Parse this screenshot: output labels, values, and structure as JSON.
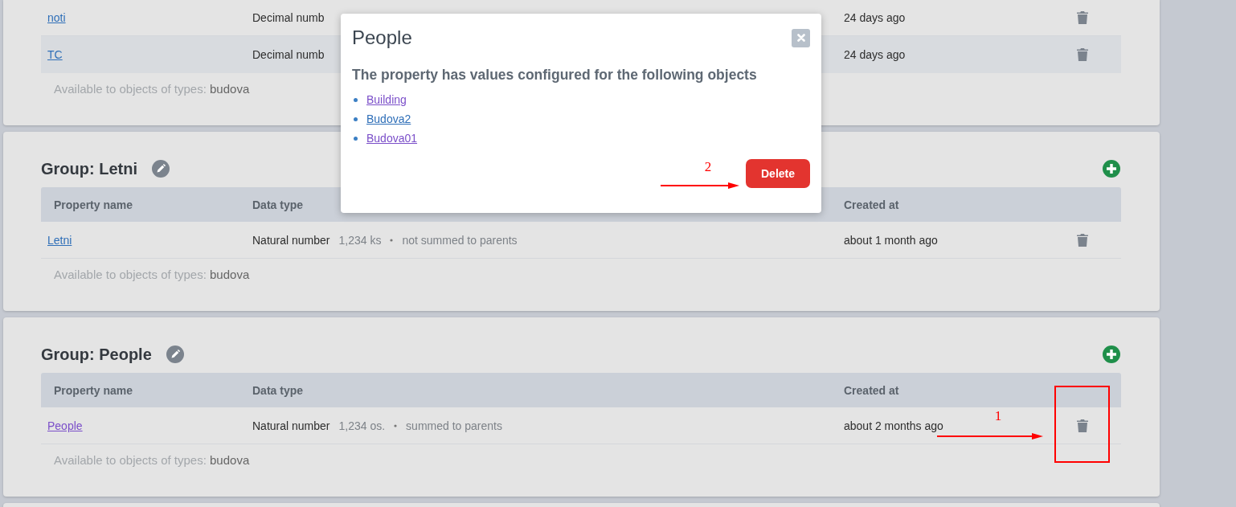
{
  "groups": [
    {
      "rows": [
        {
          "name": "noti",
          "visited": false,
          "highlighted": false,
          "data_type": "Decimal numb",
          "created": "24 days ago"
        },
        {
          "name": "TC",
          "visited": false,
          "highlighted": true,
          "data_type": "Decimal numb",
          "created": "24 days ago"
        }
      ],
      "available_label": "Available to objects of types:",
      "available_types": "budova"
    },
    {
      "title": "Group: Letni",
      "columns": [
        "Property name",
        "Data type",
        "Created at"
      ],
      "rows": [
        {
          "name": "Letni",
          "visited": false,
          "highlighted": false,
          "data_type": "Natural number",
          "example": "1,234 ks",
          "summing": "not summed to parents",
          "created": "about 1 month ago"
        }
      ],
      "available_label": "Available to objects of types:",
      "available_types": "budova"
    },
    {
      "title": "Group: People",
      "columns": [
        "Property name",
        "Data type",
        "Created at"
      ],
      "rows": [
        {
          "name": "People",
          "visited": true,
          "highlighted": false,
          "data_type": "Natural number",
          "example": "1,234 os.",
          "summing": "summed to parents",
          "created": "about 2 months ago"
        }
      ],
      "available_label": "Available to objects of types:",
      "available_types": "budova"
    }
  ],
  "modal": {
    "title": "People",
    "message": "The property has values configured for the following objects",
    "objects": [
      {
        "name": "Building",
        "visited": true
      },
      {
        "name": "Budova2",
        "visited": false
      },
      {
        "name": "Budova01",
        "visited": true
      }
    ],
    "button": "Delete"
  },
  "annotations": [
    {
      "kind": "arrow",
      "label": "2"
    },
    {
      "kind": "arrow",
      "label": "1"
    },
    {
      "kind": "box"
    }
  ]
}
